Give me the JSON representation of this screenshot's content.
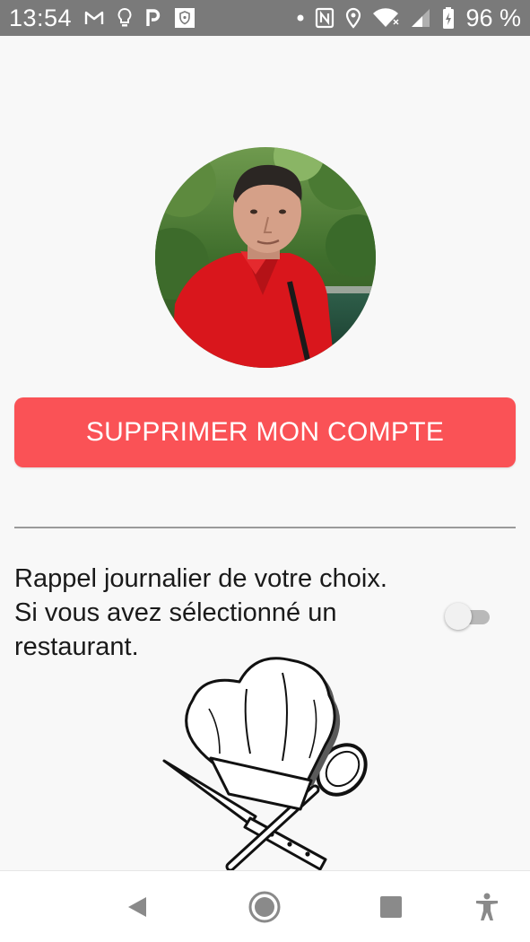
{
  "status_bar": {
    "time": "13:54",
    "battery_text": "96 %",
    "left_icons": [
      "gmail-icon",
      "bulb-icon",
      "parking-icon",
      "shield-app-icon"
    ],
    "right_icons": [
      "dot-icon",
      "nfc-icon",
      "location-icon",
      "wifi-icon",
      "signal-icon",
      "battery-icon"
    ]
  },
  "profile": {
    "avatar_alt": "profile-photo"
  },
  "delete_account": {
    "label": "SUPPRIMER MON COMPTE",
    "color": "#fa5256"
  },
  "reminder": {
    "line1": "Rappel journalier de votre choix.",
    "line2": "Si vous avez sélectionné un",
    "line3": "restaurant.",
    "enabled": false
  },
  "nav_bar": {
    "buttons": [
      "back-icon",
      "home-icon",
      "recents-icon",
      "accessibility-icon"
    ]
  }
}
